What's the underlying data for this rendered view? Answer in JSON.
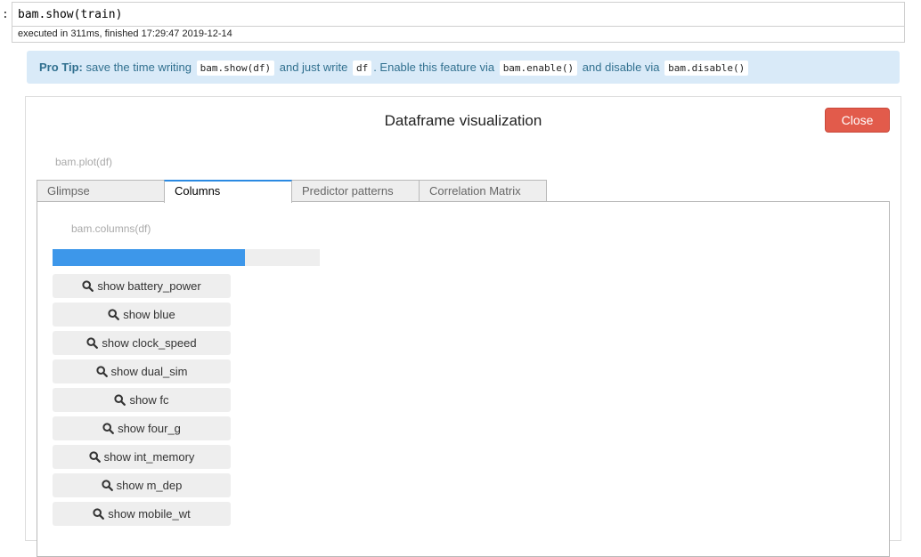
{
  "cell": {
    "prompt": ":",
    "code": "bam.show(train)",
    "exec_info": "executed in 311ms, finished 17:29:47 2019-12-14"
  },
  "protip": {
    "label": "Pro Tip:",
    "text1": "save the time writing",
    "code1": "bam.show(df)",
    "text2": "and just write",
    "code2": "df",
    "text3": ". Enable this feature via",
    "code3": "bam.enable()",
    "text4": "and disable via",
    "code4": "bam.disable()"
  },
  "panel": {
    "title": "Dataframe visualization",
    "close_label": "Close",
    "plot_caption": "bam.plot(df)",
    "tabs": [
      {
        "label": "Glimpse",
        "active": false
      },
      {
        "label": "Columns",
        "active": true
      },
      {
        "label": "Predictor patterns",
        "active": false
      },
      {
        "label": "Correlation Matrix",
        "active": false
      }
    ],
    "columns_caption": "bam.columns(df)",
    "progress_fraction": 0.72,
    "progress_color": "#3d97ea",
    "column_buttons": [
      "show battery_power",
      "show blue",
      "show clock_speed",
      "show dual_sim",
      "show fc",
      "show four_g",
      "show int_memory",
      "show m_dep",
      "show mobile_wt"
    ],
    "button_icon": "search-icon"
  }
}
